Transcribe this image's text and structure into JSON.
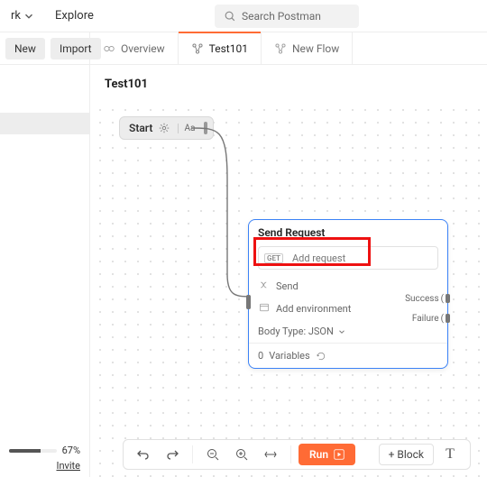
{
  "header": {
    "workspace_dd_suffix": "rk",
    "explore_label": "Explore",
    "search_placeholder": "Search Postman"
  },
  "actions": {
    "new_label": "New",
    "import_label": "Import"
  },
  "tabs": [
    {
      "label": "Overview",
      "active": false
    },
    {
      "label": "Test101",
      "active": true
    },
    {
      "label": "New Flow",
      "active": false
    }
  ],
  "flow": {
    "title": "Test101",
    "start_label": "Start",
    "start_font_chip": "Aa"
  },
  "request_node": {
    "title": "Send Request",
    "verb_badge": "GET",
    "add_request_placeholder": "Add request",
    "send_label": "Send",
    "add_env_label": "Add environment",
    "body_type_label": "Body Type: JSON",
    "success_label": "Success",
    "failure_label": "Failure",
    "variables_count": "0",
    "variables_label": "Variables"
  },
  "sidebar": {
    "progress_pct": "67%",
    "invite_label": "Invite"
  },
  "toolbar": {
    "run_label": "Run",
    "block_label": "Block"
  }
}
